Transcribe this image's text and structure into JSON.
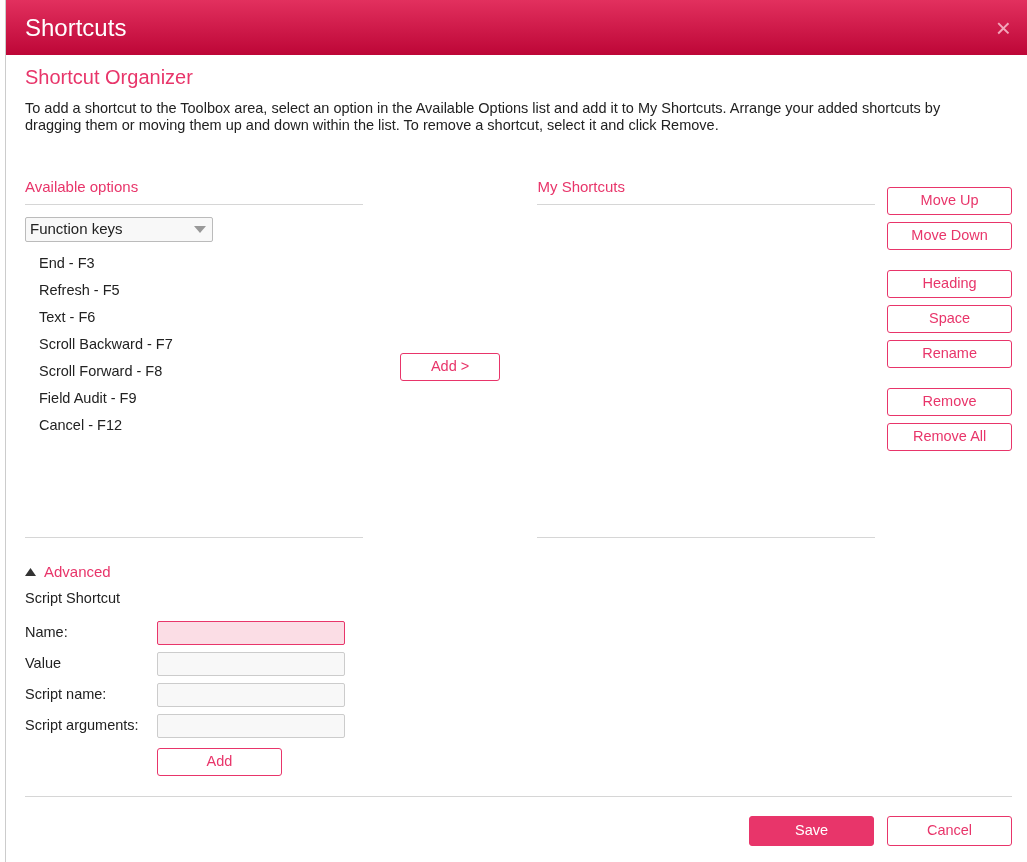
{
  "window": {
    "title": "Shortcuts",
    "close": "×"
  },
  "heading": "Shortcut Organizer",
  "description": "To add a shortcut to the Toolbox area, select an option in the Available Options list and add it to My Shortcuts. Arrange your added shortcuts by dragging them or moving them up and down within the list. To remove a shortcut, select it and click Remove.",
  "available": {
    "title": "Available options",
    "category": "Function keys",
    "items": [
      {
        "label": "End - F3",
        "selected": false
      },
      {
        "label": "Refresh - F5",
        "selected": false
      },
      {
        "label": "Text - F6",
        "selected": false
      },
      {
        "label": "Scroll Backward - F7",
        "selected": false
      },
      {
        "label": "Scroll Forward - F8",
        "selected": false
      },
      {
        "label": "Field Audit - F9",
        "selected": false
      },
      {
        "label": "Cancel - F12",
        "selected": false
      }
    ]
  },
  "add_button": "Add >",
  "my_shortcuts": {
    "title": "My Shortcuts"
  },
  "action_groups": [
    [
      "Move Up",
      "Move Down"
    ],
    [
      "Heading",
      "Space",
      "Rename"
    ],
    [
      "Remove",
      "Remove All"
    ]
  ],
  "advanced": {
    "label": "Advanced",
    "expanded": true,
    "section": "Script Shortcut",
    "fields": [
      {
        "label": "Name:",
        "invalid": true
      },
      {
        "label": "Value",
        "invalid": false
      },
      {
        "label": "Script name:",
        "invalid": false
      },
      {
        "label": "Script arguments:",
        "invalid": false
      }
    ],
    "add_button": "Add"
  },
  "footer": {
    "buttons": [
      {
        "label": "Save",
        "kind": "primary"
      },
      {
        "label": "Cancel",
        "kind": "secondary"
      }
    ]
  }
}
